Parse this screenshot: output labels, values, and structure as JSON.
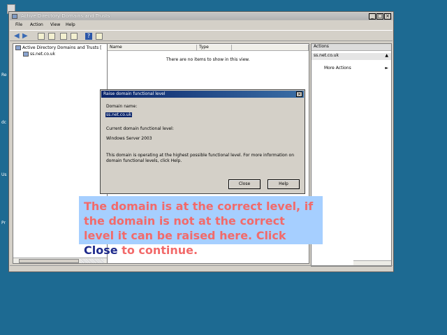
{
  "desktop": {
    "labels": [
      "Re",
      "dc",
      "Us",
      "Pr"
    ]
  },
  "window": {
    "title": "Active Directory Domains and Trusts",
    "controls": {
      "minimize": "_",
      "maximize": "□",
      "close": "×"
    },
    "menu": [
      "File",
      "Action",
      "View",
      "Help"
    ],
    "toolbar_icons": [
      "back-arrow-icon",
      "forward-arrow-icon",
      "folder-up-icon",
      "properties-icon",
      "export-icon",
      "refresh-icon",
      "help-icon",
      "console-tree-icon"
    ]
  },
  "tree": {
    "root": "Active Directory Domains and Trusts [",
    "child": "ss.net.co.uk"
  },
  "list": {
    "columns": [
      "Name",
      "Type"
    ],
    "empty_message": "There are no items to show in this view."
  },
  "actions": {
    "header": "Actions",
    "section": "ss.net.co.uk",
    "section_caret": "▲",
    "item": "More Actions",
    "item_arrow": "►"
  },
  "dialog": {
    "title": "Raise domain functional level",
    "domain_name_label": "Domain name:",
    "domain_name_value": "ss.net.co.uk",
    "current_level_label": "Current domain functional level:",
    "current_level_value": "Windows Server 2003",
    "info_text": "This domain is operating at the highest possible functional level. For more information on domain functional levels, click Help.",
    "close_label": "Close",
    "help_label": "Help",
    "close_x": "×"
  },
  "callout": {
    "text_before": "The domain is at the correct level, if the domain is not at the correct level it can be raised here. Click ",
    "highlight": "Close",
    "text_after": " to continue."
  },
  "colors": {
    "desktop": "#1d6a92",
    "callout_bg": "#a6cfff",
    "callout_text": "#f26a6a",
    "callout_highlight": "#1e2a8c",
    "selection": "#0a246a"
  }
}
